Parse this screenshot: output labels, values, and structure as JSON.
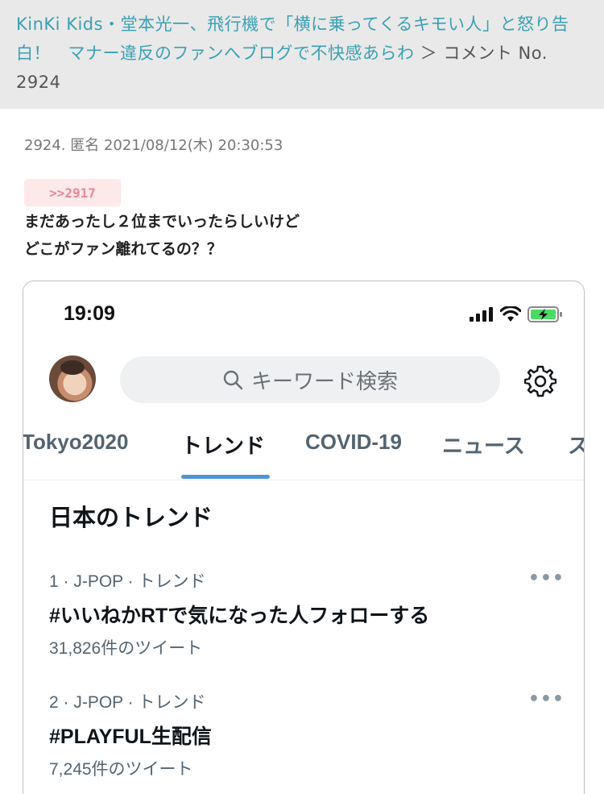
{
  "header": {
    "link_title": "KinKi Kids・堂本光一、飛行機で「横に乗ってくるキモい人」と怒り告白！　マナー違反のファンへブログで不快感あらわ",
    "separator": " ＞ ",
    "crumb_tail": "コメント No. 2924"
  },
  "comment": {
    "meta": "2924. 匿名 2021/08/12(木) 20:30:53",
    "reply_anchor": ">>2917",
    "lines": [
      "まだあったし２位までいったらしいけど",
      "どこがファン離れてるの？？"
    ]
  },
  "screenshot": {
    "status_time": "19:09",
    "search_placeholder": "キーワード検索",
    "tabs": [
      "Tokyo2020",
      "トレンド",
      "COVID-19",
      "ニュース",
      "ス"
    ],
    "section_title": "日本のトレンド",
    "trends": [
      {
        "meta": "1 · J-POP · トレンド",
        "name": "#いいねかRTで気になった人フォローする",
        "count": "31,826件のツイート"
      },
      {
        "meta": "2 · J-POP · トレンド",
        "name": "#PLAYFUL生配信",
        "count": "7,245件のツイート"
      }
    ],
    "more_label": "•••",
    "icons": [
      "signal-icon",
      "wifi-icon",
      "battery-charging-icon",
      "search-icon",
      "gear-icon"
    ],
    "colors": {
      "tab_underline": "#4f94d4",
      "battery": "#4cd964",
      "link": "#3aa0b3"
    }
  }
}
